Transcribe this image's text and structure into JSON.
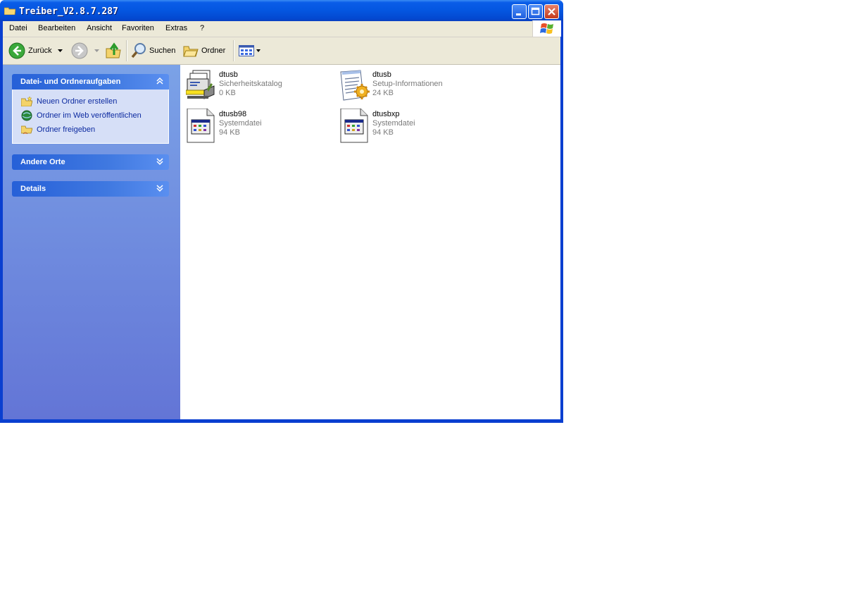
{
  "window": {
    "title": "Treiber_V2.8.7.287"
  },
  "menu": [
    {
      "label": "Datei"
    },
    {
      "label": "Bearbeiten"
    },
    {
      "label": "Ansicht"
    },
    {
      "label": "Favoriten"
    },
    {
      "label": "Extras"
    },
    {
      "label": "?"
    }
  ],
  "toolbar": {
    "back_label": "Zurück",
    "search_label": "Suchen",
    "folders_label": "Ordner"
  },
  "taskpane": {
    "groups": [
      {
        "title": "Datei- und Ordneraufgaben",
        "expanded": true,
        "tasks": [
          {
            "label": "Neuen Ordner erstellen",
            "icon": "new-folder-icon"
          },
          {
            "label": "Ordner im Web veröffentlichen",
            "icon": "web-publish-icon"
          },
          {
            "label": "Ordner freigeben",
            "icon": "share-folder-icon"
          }
        ]
      },
      {
        "title": "Andere Orte",
        "expanded": false
      },
      {
        "title": "Details",
        "expanded": false
      }
    ]
  },
  "files": [
    {
      "name": "dtusb",
      "type": "Sicherheitskatalog",
      "size": "0 KB",
      "icon": "security-catalog-icon"
    },
    {
      "name": "dtusb",
      "type": "Setup-Informationen",
      "size": "24 KB",
      "icon": "setup-info-icon"
    },
    {
      "name": "dtusb98",
      "type": "Systemdatei",
      "size": "94 KB",
      "icon": "system-file-icon"
    },
    {
      "name": "dtusbxp",
      "type": "Systemdatei",
      "size": "94 KB",
      "icon": "system-file-icon"
    }
  ],
  "colors": {
    "titlebar": "#0456e0",
    "taskpane": "#6d8fe0",
    "link": "#0c2aa0"
  }
}
